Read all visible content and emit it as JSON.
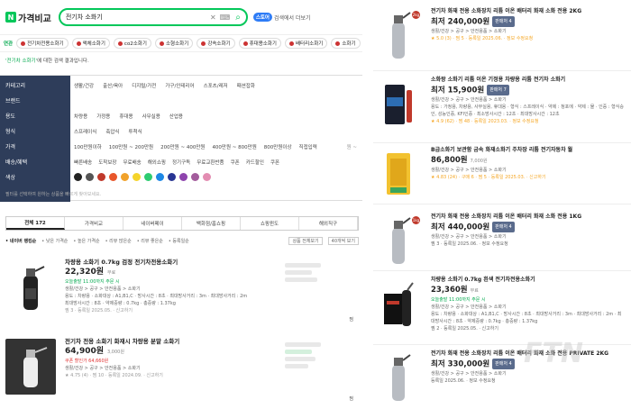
{
  "header": {
    "logo_mark": "N",
    "logo_text": "가격비교",
    "search_value": "전기차 소화기",
    "store_label": "스토어",
    "store_text": "검색에서 더보기"
  },
  "tags": {
    "label": "연관",
    "items": [
      "전기차전용소화기",
      "액체소화기",
      "co2소화기",
      "소형소화기",
      "강속소화기",
      "휴대용소화기",
      "배터리소화기",
      "소화기"
    ]
  },
  "notice": {
    "query": "'전기차 소화기'",
    "text": "에 대한 검색 결과입니다."
  },
  "filter": {
    "rows": [
      {
        "key": "카테고리",
        "opts": [
          "생활/건강",
          "출산/육아",
          "디지털/가전",
          "가구/인테리어",
          "스포츠/레저",
          "패션잡화"
        ]
      },
      {
        "key": "브랜드",
        "opts": [],
        "more": ""
      },
      {
        "key": "용도",
        "opts": [
          "차량용",
          "가정용",
          "휴대용",
          "사무실용",
          "산업용"
        ]
      },
      {
        "key": "형식",
        "opts": [
          "스프레이식",
          "축압식",
          "투척식"
        ]
      },
      {
        "key": "가격",
        "opts": [
          "100만원이하",
          "100만원 ~ 200만원",
          "200만원 ~ 400만원",
          "400만원 ~ 800만원",
          "800만원이상",
          "직접입력"
        ],
        "more": "원 ~"
      },
      {
        "key": "배송/혜택",
        "opts": [
          "빠른배송",
          "도착보장",
          "무료배송",
          "해외쇼핑",
          "정기구독",
          "무료교환반품",
          "쿠폰",
          "카드할인",
          "쿠폰"
        ]
      },
      {
        "key": "색상",
        "opts": []
      }
    ],
    "note": "필터를 선택하여 원하는 상품을 빠르게 찾아보세요.",
    "swatch_colors": [
      "#222222",
      "#555555",
      "#c0392b",
      "#e8572b",
      "#f1a22b",
      "#f5d42b",
      "#2ecc71",
      "#1e88e5",
      "#283593",
      "#8e44ad",
      "#a35c9c",
      "#e38db2"
    ]
  },
  "tabs": [
    "전체 172",
    "가격비교",
    "네이버페이",
    "백화점/홈쇼핑",
    "쇼핑윈도",
    "해외직구"
  ],
  "sort": {
    "items": [
      "• 네이버 랭킹순",
      "• 낮은 가격순",
      "• 높은 가격순",
      "• 리뷰 많은순",
      "• 리뷰 좋은순",
      "• 등록일순"
    ],
    "select1": "상품 전체보기",
    "select2": "40개씩 보기"
  },
  "products": [
    {
      "name": "차량용 소화기 0.7kg 검정 전기차전용소화기",
      "price": "22,320원",
      "ship": "무료",
      "delivery": "오늘출발 11:00까지 주문 시",
      "cat": "생활/건강 > 공구 > 안전용품 > 소화기",
      "spec1": "용도 : 차량용 · 소화대상 : A1,B1,C · 방사시간 : 8초 · 최대방사거리 : 3m · 최대방사거리 : 2m",
      "spec2": "최대방사시간 : 8초 · 약제중량 : 0.7kg · 총중량 : 1.37kg",
      "meta": "찜 3 · 등록일 2025.05. · 신고하기",
      "zzim": "찜"
    },
    {
      "name": "전기차 전용 소화기 화재시 차량용 분말 소화기",
      "price": "64,900원",
      "ship": "3,000원",
      "coupon": "쿠폰 할인가 64,660원",
      "cat": "생활/건강 > 공구 > 안전용품 > 소화기",
      "meta": "★ 4.75 (4) · 찜 10 · 등록일 2024.09. · 신고하기",
      "zzim": "찜"
    }
  ],
  "right_cards": [
    {
      "name": "전기차 화재 전용 소화장치 리튬 이온 배터리 화재 소화 전용 2KG",
      "price": "최저 240,000원",
      "pill": "판매처 4",
      "cat": "생활/건강 > 공구 > 안전용품 > 소화기",
      "meta": "★ 5.0 (3) · 찜 5 · 등록일 2025.06. · 정보 수정요청"
    },
    {
      "name": "소화왕 소화기 리튬 이온 기정용 차량용 리튬 전기차 소화기",
      "price": "최저 15,900원",
      "pill": "판매처 7",
      "cat": "생활/건강 > 공구 > 안전용품 > 소화기",
      "spec": "용도 : 가정용, 차량용, 사무실용, 휴대용 · 형식 : 스프레이식 · 약제 : 청포에 · 약제 : 물 · 인증 : 형식승인, 성능인증, KFI인증 · 최소방사시간 : 12초 · 최대방사시간 : 12초",
      "meta": "★ 4.9 (62) · 찜 48 · 등록일 2023.03. · 정보 수정요청"
    },
    {
      "name": "B급소화기 보관함 금속 화재소화기 주차장 리튬 전기자동차 월",
      "price": "86,800원",
      "ship": "7,000원",
      "cat": "생활/건강 > 공구 > 안전용품 > 소화기",
      "meta": "★ 4.83 (24) · 구매 6 · 찜 5 · 등록일 2025.03. · 신고하기"
    },
    {
      "name": "전기차 화재 전용 소화장치 리튬 이온 배터리 화재 소화 전용 1KG",
      "price": "최저 440,000원",
      "pill": "판매처 4",
      "cat": "생활/건강 > 공구 > 안전용품 > 소화기",
      "meta": "찜 3 · 등록일 2025.06. · 정보 수정요청"
    },
    {
      "name": "차량용 소화기 0.7kg 흰색 전기차전용소화기",
      "price": "23,360원",
      "ship": "무료",
      "delivery": "오늘출발 11:00까지 주문 시",
      "cat": "생활/건강 > 공구 > 안전용품 > 소화기",
      "spec": "용도 : 차량용 · 소화대상 : A1,B1,C · 방사시간 : 8초 · 최대방사거리 : 3m · 최대방사거리 : 2m · 최대방사시간 : 8초 · 약제중량 : 0.7kg · 총중량 : 1.37kg",
      "meta": "찜 2 · 등록일 2025.05. · 신고하기"
    },
    {
      "name": "전기차 화재 전용 소화장치 리튬 이온 배터리 화재 소화 전용 PRIVATE 2KG",
      "price": "최저 330,000원",
      "pill": "판매처 4",
      "cat": "생활/건강 > 공구 > 안전용품 > 소화기",
      "meta": "등록일 2025.06. · 정보 수정요청"
    }
  ]
}
